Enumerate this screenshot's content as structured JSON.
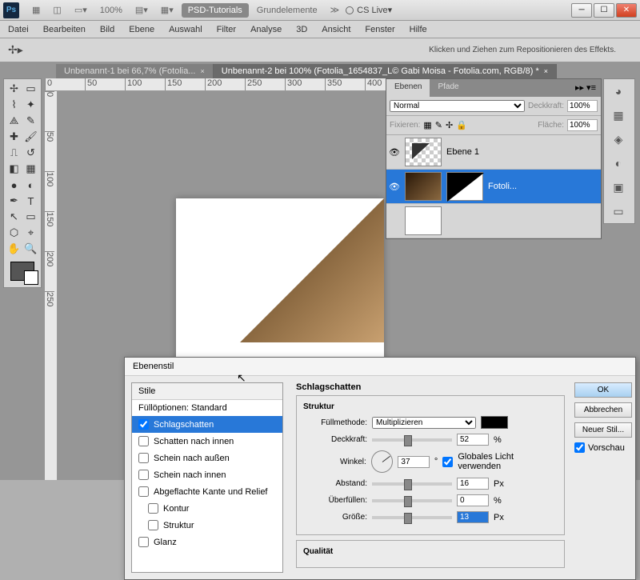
{
  "titlebar": {
    "ps": "Ps",
    "zoom": "100%",
    "workspace1": "PSD-Tutorials",
    "workspace2": "Grundelemente",
    "cslive": "CS Live"
  },
  "menu": {
    "m0": "Datei",
    "m1": "Bearbeiten",
    "m2": "Bild",
    "m3": "Ebene",
    "m4": "Auswahl",
    "m5": "Filter",
    "m6": "Analyse",
    "m7": "3D",
    "m8": "Ansicht",
    "m9": "Fenster",
    "m10": "Hilfe"
  },
  "optbar": {
    "hint": "Klicken und Ziehen zum Repositionieren des Effekts."
  },
  "tabs": {
    "t0": "Unbenannt-1 bei 66,7% (Fotolia...",
    "t1": "Unbenannt-2 bei 100% (Fotolia_1654837_L© Gabi Moisa - Fotolia.com, RGB/8) *"
  },
  "layers": {
    "tab0": "Ebenen",
    "tab1": "Pfade",
    "mode": "Normal",
    "opLbl": "Deckkraft:",
    "op": "100%",
    "fixLbl": "Fixieren:",
    "fillLbl": "Fläche:",
    "fill": "100%",
    "l0": "Ebene 1",
    "l1": "Fotoli..."
  },
  "dialog": {
    "title": "Ebenenstil",
    "stylesHdr": "Stile",
    "opts": "Füllöptionen: Standard",
    "s0": "Schlagschatten",
    "s1": "Schatten nach innen",
    "s2": "Schein nach außen",
    "s3": "Schein nach innen",
    "s4": "Abgeflachte Kante und Relief",
    "s5": "Kontur",
    "s6": "Struktur",
    "s7": "Glanz",
    "section": "Schlagschatten",
    "struct": "Struktur",
    "quality": "Qualität",
    "blendLbl": "Füllmethode:",
    "blend": "Multiplizieren",
    "opacityLbl": "Deckkraft:",
    "opacity": "52",
    "pct": "%",
    "angleLbl": "Winkel:",
    "angle": "37",
    "deg": "°",
    "global": "Globales Licht verwenden",
    "distLbl": "Abstand:",
    "dist": "16",
    "px": "Px",
    "spreadLbl": "Überfüllen:",
    "spread": "0",
    "sizeLbl": "Größe:",
    "size": "13",
    "btnOk": "OK",
    "btnCancel": "Abbrechen",
    "btnNew": "Neuer Stil...",
    "preview": "Vorschau"
  }
}
